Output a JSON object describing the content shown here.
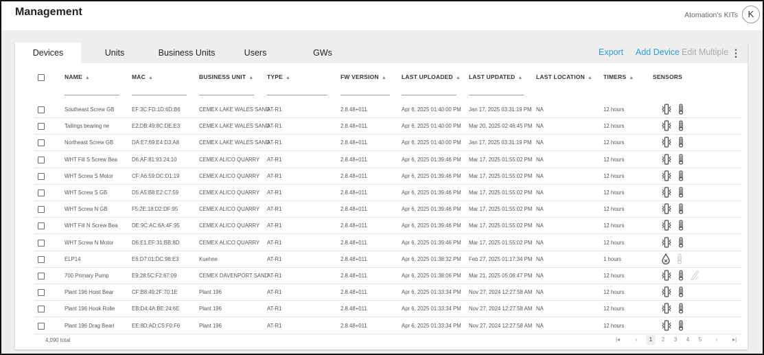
{
  "header": {
    "title": "Management",
    "org": "Atomation's KITs",
    "avatar": "K"
  },
  "tabs": [
    {
      "label": "Devices",
      "active": true
    },
    {
      "label": "Units"
    },
    {
      "label": "Business Units"
    },
    {
      "label": "Users"
    },
    {
      "label": "GWs"
    }
  ],
  "actions": {
    "export": "Export",
    "add_device": "Add Device",
    "edit_multiple": "Edit Multiple",
    "more_icon": "kebab-icon"
  },
  "colors": {
    "accent": "#2f9bd6",
    "disabled": "#aaaaaa"
  },
  "columns": [
    "NAME",
    "MAC",
    "BUSINESS UNIT",
    "TYPE",
    "FW VERSION",
    "LAST UPLOADED",
    "LAST UPDATED",
    "LAST LOCATION",
    "TIMERS",
    "SENSORS"
  ],
  "rows": [
    {
      "name": "Southeast Screw GB",
      "mac": "EF:3C:FD:1D:6D:B6",
      "bu": "CEMEX LAKE WALES SAND",
      "type": "AT-R1",
      "fw": "2.8.48+011",
      "uploaded": "Apr 6, 2025 01:40:00 PM",
      "updated": "Jan 17, 2025 03:31:19 PM",
      "location": "NA",
      "timers": "12 hours",
      "sensors": [
        {
          "icon": "vibration",
          "active": true
        },
        {
          "icon": "thermometer",
          "active": true
        }
      ]
    },
    {
      "name": "Tailings bearing ne",
      "mac": "E2:DB:49:8C:DE:E3",
      "bu": "CEMEX LAKE WALES SAND",
      "type": "AT-R1",
      "fw": "2.8.48+011",
      "uploaded": "Apr 6, 2025 01:40:00 PM",
      "updated": "Mar 20, 2025 02:46:45 PM",
      "location": "NA",
      "timers": "12 hours",
      "sensors": [
        {
          "icon": "vibration",
          "active": true
        },
        {
          "icon": "thermometer",
          "active": true
        }
      ]
    },
    {
      "name": "Northeast Screw GB",
      "mac": "DA:E7:69:E4:D3:A8",
      "bu": "CEMEX LAKE WALES SAND",
      "type": "AT-R1",
      "fw": "2.8.48+011",
      "uploaded": "Apr 6, 2025 01:40:00 PM",
      "updated": "Jan 17, 2025 03:31:19 PM",
      "location": "NA",
      "timers": "12 hours",
      "sensors": [
        {
          "icon": "vibration",
          "active": true
        },
        {
          "icon": "thermometer",
          "active": true
        }
      ]
    },
    {
      "name": "WHT Fill S Screw Bea",
      "mac": "D6:AF:81:93:24:10",
      "bu": "CEMEX ALICO QUARRY",
      "type": "AT-R1",
      "fw": "2.8.48+011",
      "uploaded": "Apr 6, 2025 01:39:46 PM",
      "updated": "Mar 17, 2025 01:55:02 PM",
      "location": "NA",
      "timers": "12 hours",
      "sensors": [
        {
          "icon": "vibration",
          "active": true
        },
        {
          "icon": "thermometer",
          "active": true
        }
      ]
    },
    {
      "name": "WHT Screw S Motor",
      "mac": "CF:A6:59:DC:D1:19",
      "bu": "CEMEX ALICO QUARRY",
      "type": "AT-R1",
      "fw": "2.8.48+011",
      "uploaded": "Apr 6, 2025 01:39:46 PM",
      "updated": "Mar 17, 2025 01:55:02 PM",
      "location": "NA",
      "timers": "12 hours",
      "sensors": [
        {
          "icon": "vibration",
          "active": true
        },
        {
          "icon": "thermometer",
          "active": true
        }
      ]
    },
    {
      "name": "WHT Screw S GB",
      "mac": "D5:A5:B8:E2:C7:59",
      "bu": "CEMEX ALICO QUARRY",
      "type": "AT-R1",
      "fw": "2.8.48+011",
      "uploaded": "Apr 6, 2025 01:39:46 PM",
      "updated": "Mar 17, 2025 01:55:02 PM",
      "location": "NA",
      "timers": "12 hours",
      "sensors": [
        {
          "icon": "vibration",
          "active": true
        },
        {
          "icon": "thermometer",
          "active": true
        }
      ]
    },
    {
      "name": "WHT Screw N GB",
      "mac": "F5:2E:18:D2:DF:95",
      "bu": "CEMEX ALICO QUARRY",
      "type": "AT-R1",
      "fw": "2.8.48+011",
      "uploaded": "Apr 6, 2025 01:39:46 PM",
      "updated": "Mar 17, 2025 01:55:02 PM",
      "location": "NA",
      "timers": "12 hours",
      "sensors": [
        {
          "icon": "vibration",
          "active": true
        },
        {
          "icon": "thermometer",
          "active": true
        }
      ]
    },
    {
      "name": "WHT Fill N Screw Bea",
      "mac": "DE:9C:AC:6A:4F:95",
      "bu": "CEMEX ALICO QUARRY",
      "type": "AT-R1",
      "fw": "2.8.48+011",
      "uploaded": "Apr 6, 2025 01:39:46 PM",
      "updated": "Mar 17, 2025 01:55:02 PM",
      "location": "NA",
      "timers": "12 hours",
      "sensors": [
        {
          "icon": "vibration",
          "active": true
        },
        {
          "icon": "thermometer",
          "active": true
        }
      ]
    },
    {
      "name": "WHT Screw N Motor",
      "mac": "D6:E1:EF:31:BB:8D",
      "bu": "CEMEX ALICO QUARRY",
      "type": "AT-R1",
      "fw": "2.8.48+011",
      "uploaded": "Apr 6, 2025 01:39:46 PM",
      "updated": "Mar 17, 2025 01:55:02 PM",
      "location": "NA",
      "timers": "12 hours",
      "sensors": [
        {
          "icon": "vibration",
          "active": true
        },
        {
          "icon": "thermometer",
          "active": true
        }
      ]
    },
    {
      "name": "ELP14",
      "mac": "E6:D7:01:DC:98:E3",
      "bu": "Kuehne",
      "type": "AT-R1",
      "fw": "2.8.48+011",
      "uploaded": "Apr 6, 2025 01:38:32 PM",
      "updated": "Feb 27, 2025 01:17:34 PM",
      "location": "NA",
      "timers": "1 hours",
      "sensors": [
        {
          "icon": "humidity",
          "active": true
        },
        {
          "icon": "thermometer",
          "active": false
        }
      ]
    },
    {
      "name": "700 Primary Pump",
      "mac": "E9:28:5C:F2:67:09",
      "bu": "CEMEX DAVENPORT SAND",
      "type": "AT-R1",
      "fw": "2.8.48+011",
      "uploaded": "Apr 6, 2025 01:38:06 PM",
      "updated": "Mar 21, 2025 05:06:47 PM",
      "location": "NA",
      "timers": "12 hours",
      "sensors": [
        {
          "icon": "vibration",
          "active": true
        },
        {
          "icon": "thermometer",
          "active": true
        },
        {
          "icon": "tilt",
          "active": false
        }
      ]
    },
    {
      "name": "Plant 196 Hoist Bear",
      "mac": "CF:B8:49:2F:70:1E",
      "bu": "Plant 196",
      "type": "AT-R1",
      "fw": "2.8.48+011",
      "uploaded": "Apr 6, 2025 01:33:34 PM",
      "updated": "Nov 27, 2024 12:27:58 AM",
      "location": "NA",
      "timers": "12 hours",
      "sensors": [
        {
          "icon": "vibration",
          "active": true
        },
        {
          "icon": "thermometer",
          "active": true
        }
      ]
    },
    {
      "name": "Plant 196 Hook Rolle",
      "mac": "EB:D4:4A:BE:24:6E",
      "bu": "Plant 196",
      "type": "AT-R1",
      "fw": "2.8.48+011",
      "uploaded": "Apr 6, 2025 01:33:34 PM",
      "updated": "Nov 27, 2024 12:27:58 AM",
      "location": "NA",
      "timers": "12 hours",
      "sensors": [
        {
          "icon": "vibration",
          "active": true
        },
        {
          "icon": "thermometer",
          "active": true
        }
      ]
    },
    {
      "name": "Plant 196 Drag Beari",
      "mac": "EE:8D:AD:C5:F0:F6",
      "bu": "Plant 196",
      "type": "AT-R1",
      "fw": "2.8.48+011",
      "uploaded": "Apr 6, 2025 01:33:34 PM",
      "updated": "Nov 27, 2024 12:27:58 AM",
      "location": "NA",
      "timers": "12 hours",
      "sensors": [
        {
          "icon": "vibration",
          "active": true
        },
        {
          "icon": "thermometer",
          "active": true
        }
      ]
    }
  ],
  "footer": {
    "total": "4,090 total",
    "pages": [
      "1",
      "2",
      "3",
      "4",
      "5"
    ],
    "current_page": "1"
  }
}
